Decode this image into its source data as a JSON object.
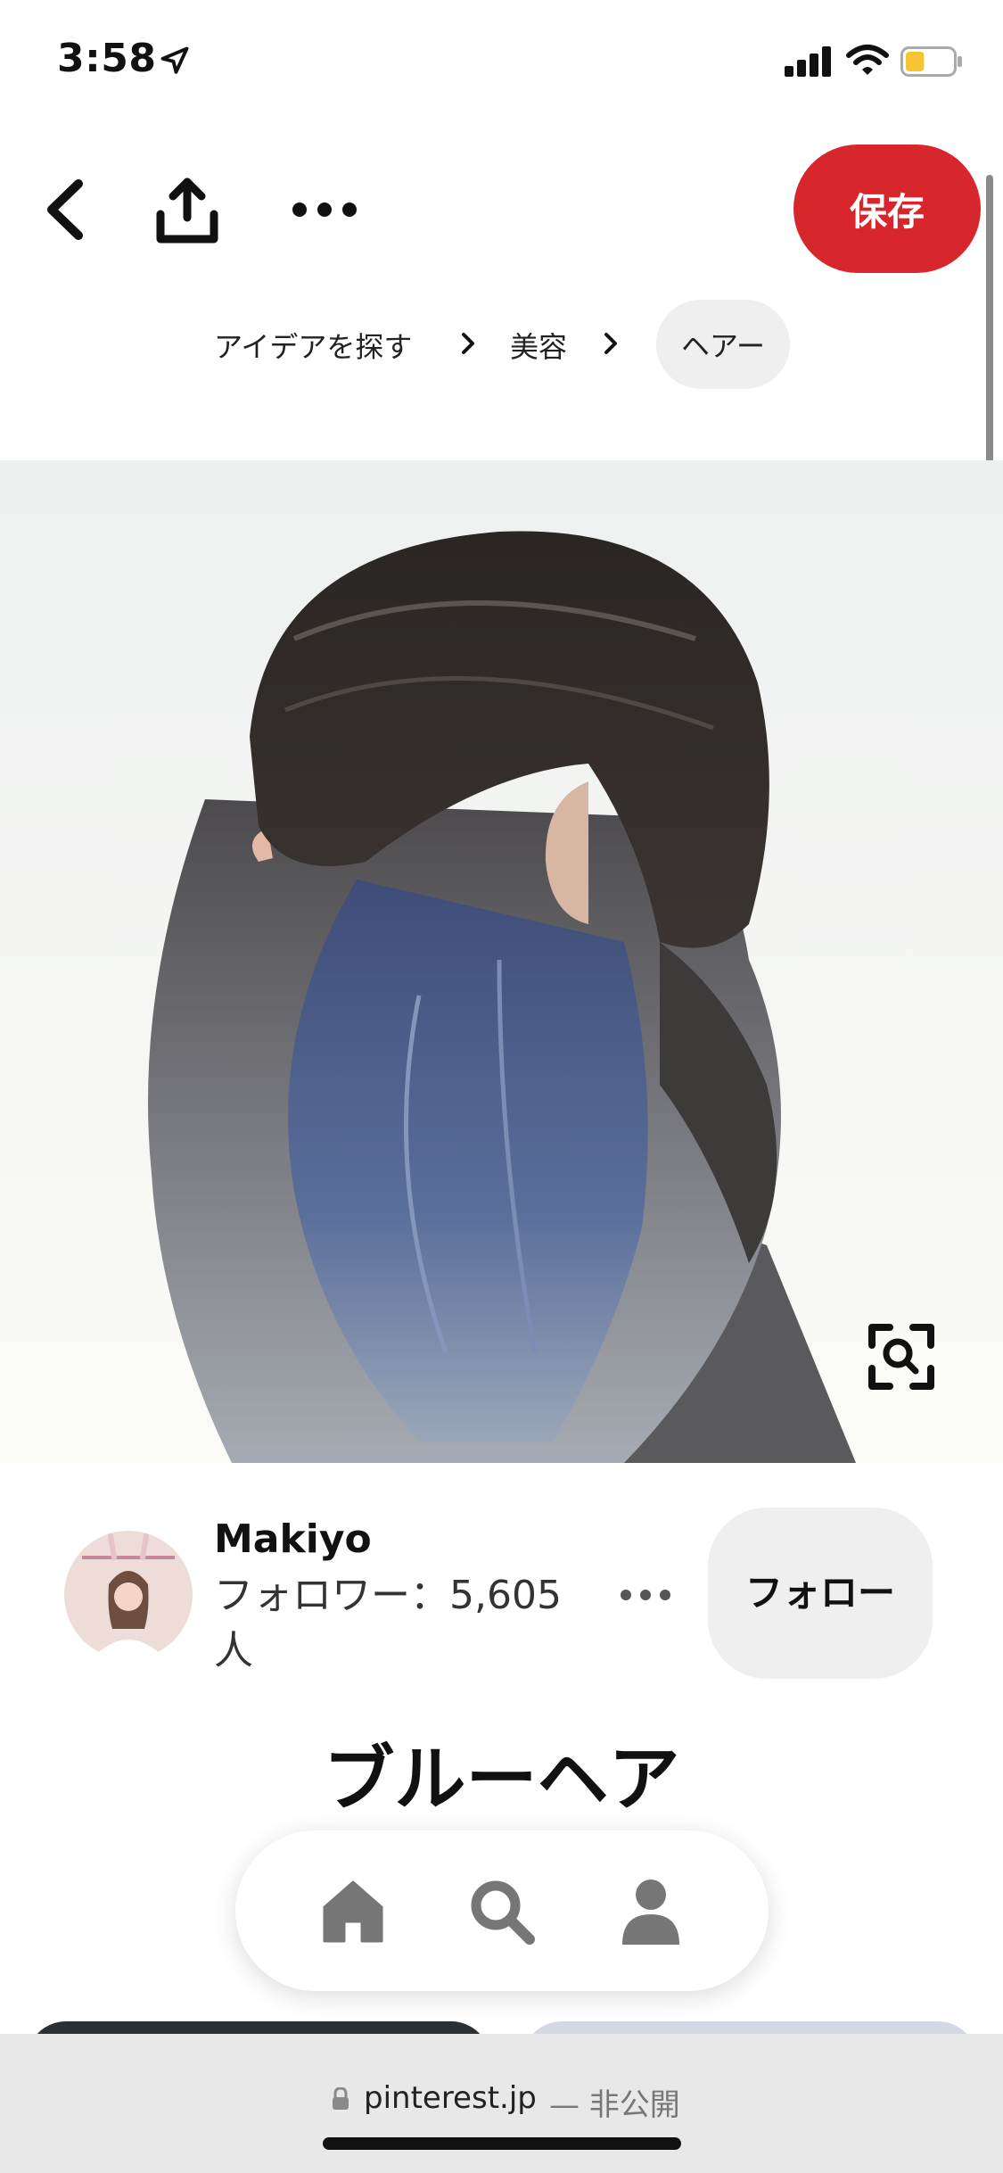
{
  "status_bar": {
    "time": "3:58",
    "location_icon": "location-arrow-icon",
    "signal_icon": "cellular-signal-icon",
    "wifi_icon": "wifi-icon",
    "battery_icon": "battery-icon",
    "battery_color": "#f5c531",
    "battery_level": 0.4
  },
  "toolbar": {
    "back_icon": "chevron-left-icon",
    "share_icon": "share-icon",
    "more_icon": "ellipsis-icon",
    "save_label": "保存",
    "save_color": "#d7262c"
  },
  "breadcrumb": {
    "items": [
      "アイデアを探す",
      "美容",
      "ヘアー"
    ]
  },
  "pin": {
    "image_icon": "hair-photo",
    "visual_search_icon": "visual-search-icon",
    "title": "ブルーヘア"
  },
  "creator": {
    "name": "Makiyo",
    "followers": "フォロワー：5,605人",
    "more_icon": "ellipsis-icon",
    "follow_label": "フォロー"
  },
  "bottom_nav": {
    "items": [
      "home-icon",
      "search-icon",
      "profile-icon"
    ]
  },
  "browser": {
    "lock_icon": "lock-icon",
    "url": "pinterest.jp",
    "private_label": "— 非公開"
  }
}
